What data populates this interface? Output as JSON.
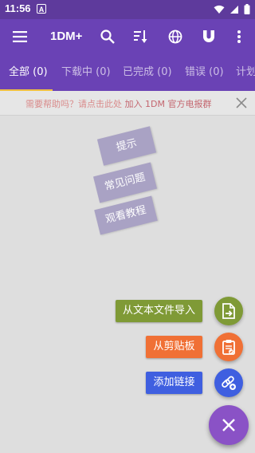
{
  "status_bar": {
    "time": "11:56",
    "alert_glyph": "A"
  },
  "app_bar": {
    "title": "1DM+",
    "menu_icon": "hamburger-menu-icon",
    "search_icon": "search-icon",
    "sort_icon": "sort-icon",
    "browser_icon": "globe-icon",
    "magnet_icon": "magnet-icon",
    "more_icon": "more-vert-icon"
  },
  "tabs": [
    {
      "label": "全部 (0)"
    },
    {
      "label": "下载中 (0)"
    },
    {
      "label": "已完成 (0)"
    },
    {
      "label": "错误 (0)"
    },
    {
      "label": "计划"
    }
  ],
  "banner": {
    "text": "需要帮助吗？请点击此处",
    "link": "加入 1DM 官方电报群"
  },
  "stickers": [
    {
      "label": "提示"
    },
    {
      "label": "常见问题"
    },
    {
      "label": "观看教程"
    }
  ],
  "fab_actions": [
    {
      "label": "从文本文件导入",
      "color": "#7f9a36",
      "icon": "file-import-icon"
    },
    {
      "label": "从剪贴板",
      "color": "#f07035",
      "icon": "clipboard-check-icon"
    },
    {
      "label": "添加链接",
      "color": "#3f5fe0",
      "icon": "add-link-icon"
    }
  ],
  "colors": {
    "app_bar": "#6a42b5",
    "status_bar": "#5e3a9c",
    "tab_indicator": "#f0c040",
    "main_fab": "#8a52c6"
  }
}
